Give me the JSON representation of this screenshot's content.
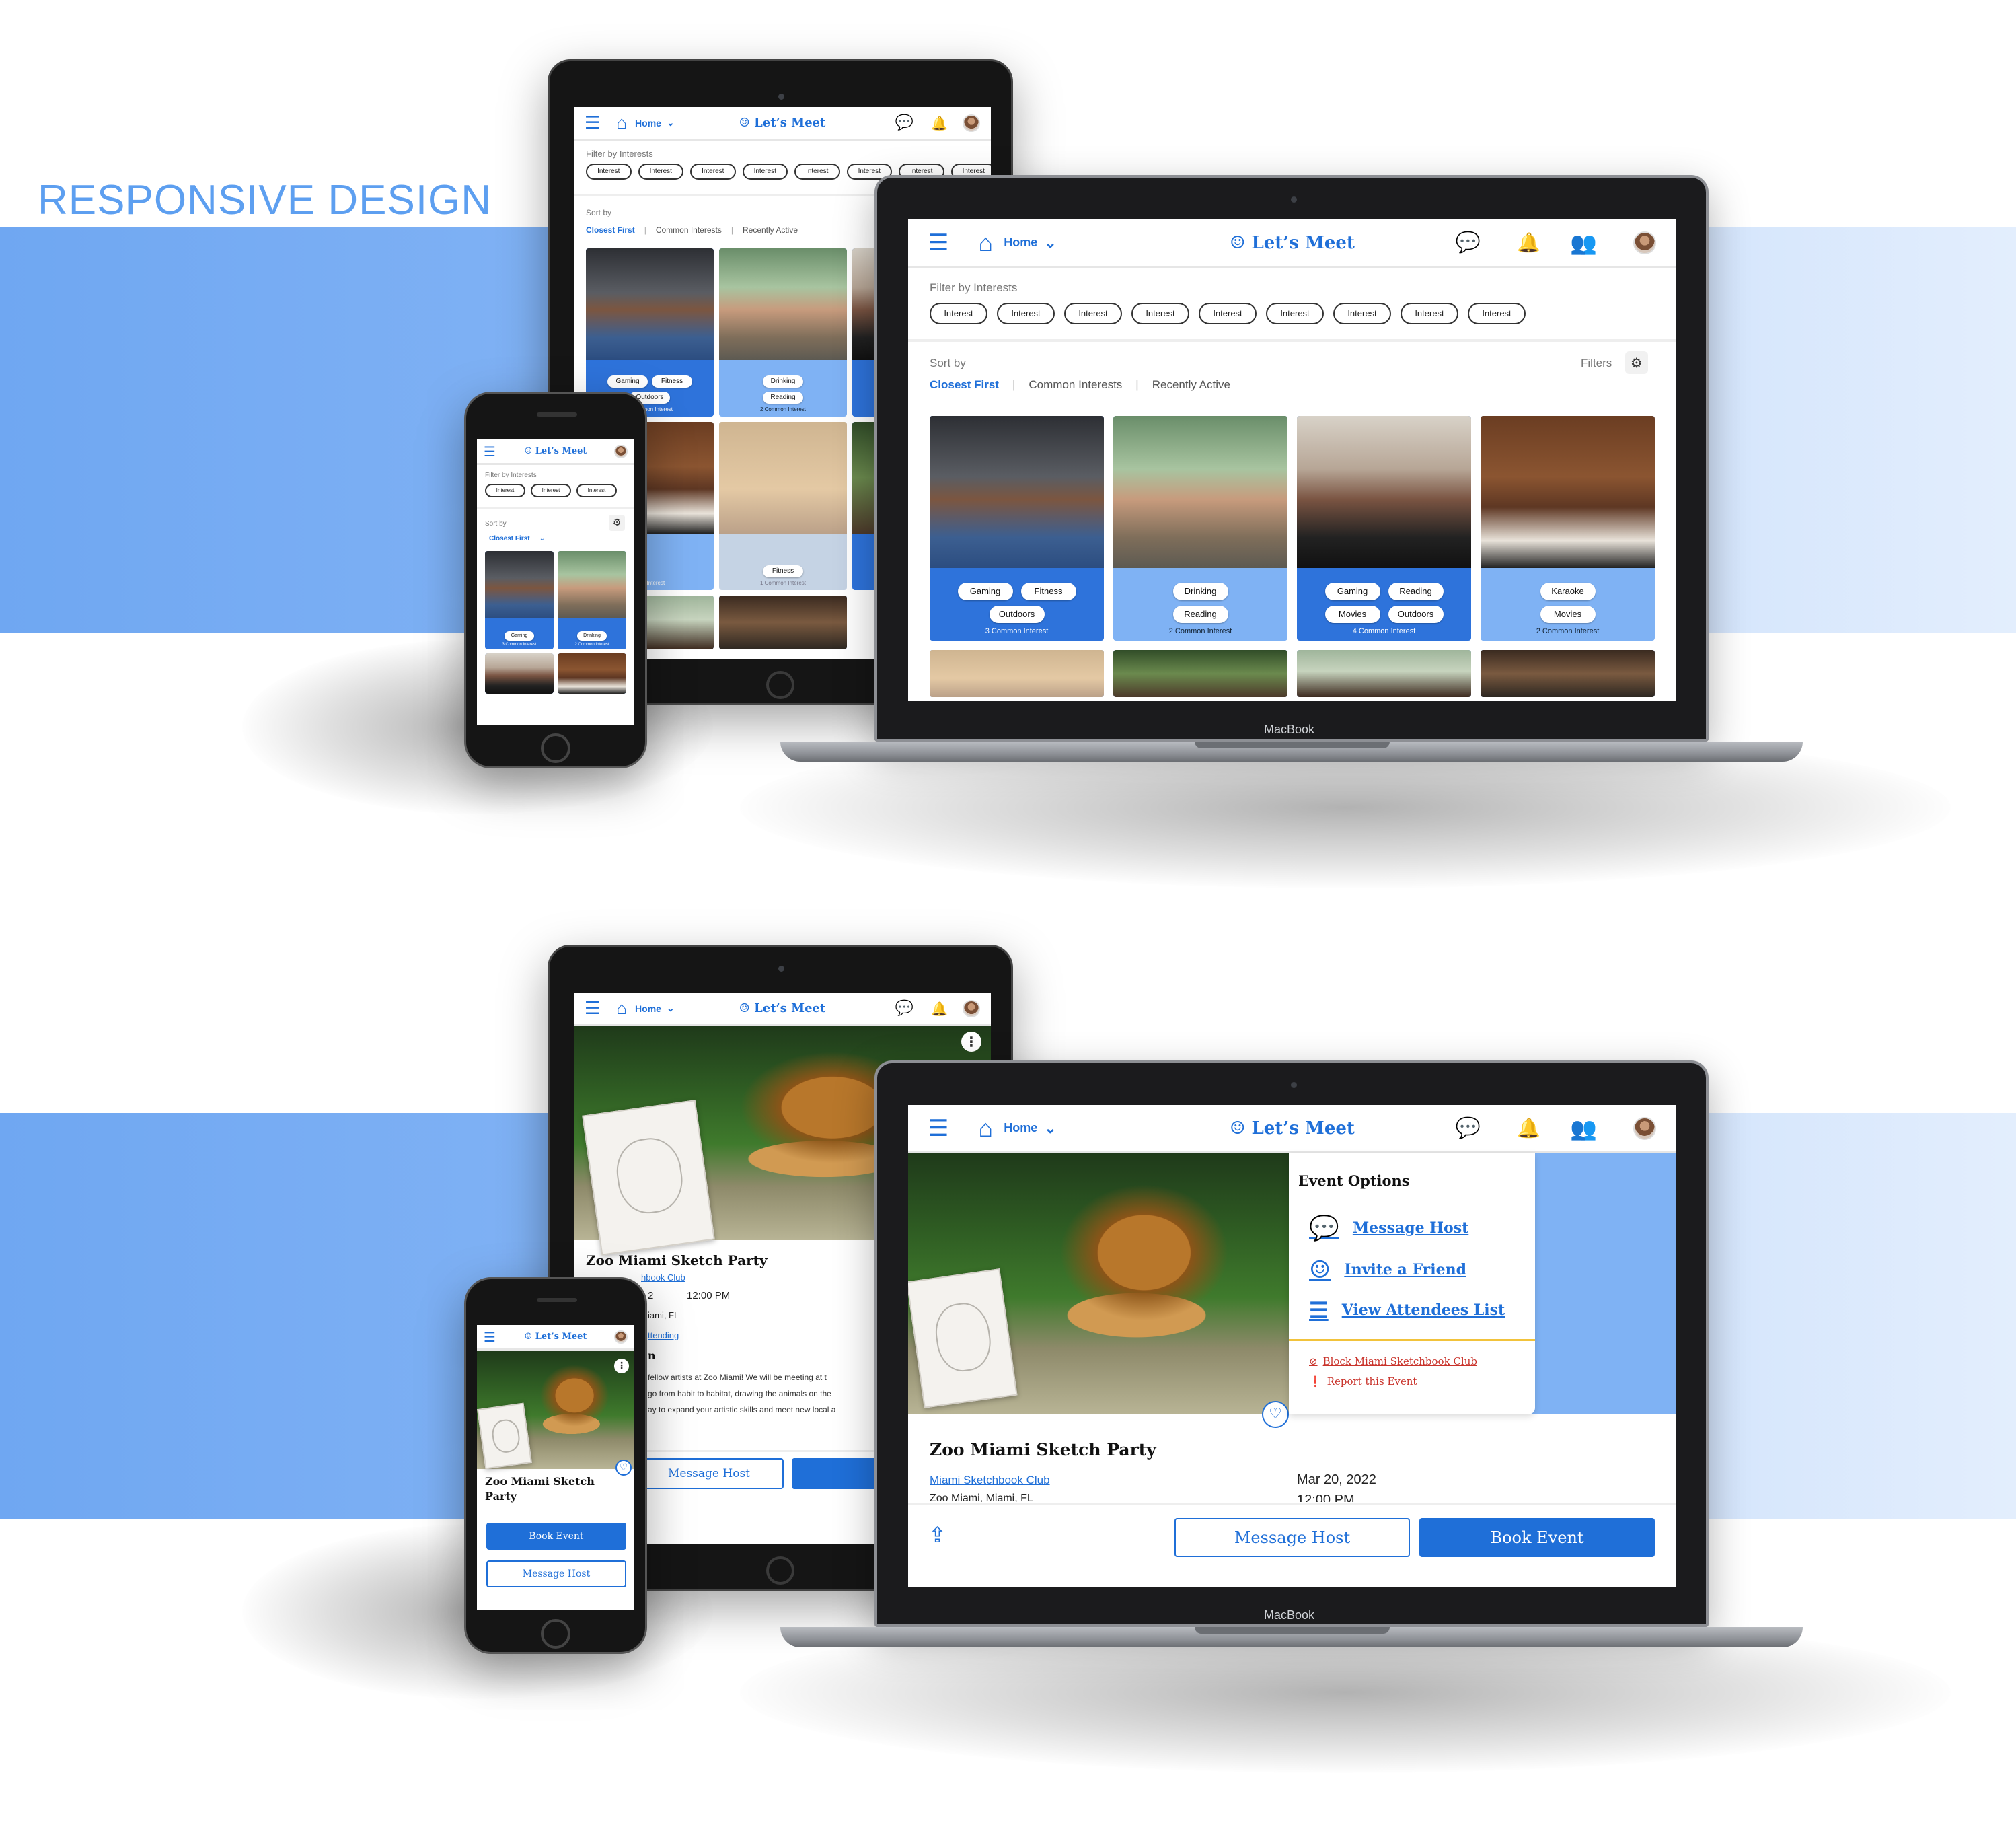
{
  "heading": "RESPONSIVE DESIGN",
  "colors": {
    "accent": "#1f6fd8",
    "band": "#6fa7f2",
    "warn": "#c9332b"
  },
  "nav": {
    "menu_icon": "hamburger-icon",
    "home_label": "Home",
    "brand": "Let’s Meet",
    "icons": [
      "chat-icon",
      "bell-icon",
      "people-icon",
      "avatar"
    ]
  },
  "browse": {
    "filter_label": "Filter by Interests",
    "chip_label": "Interest",
    "chip_count": 9,
    "sort_label": "Sort by",
    "sort_options": [
      "Closest First",
      "Common Interests",
      "Recently Active"
    ],
    "filters_label": "Filters",
    "cards": [
      {
        "tags": [
          "Gaming",
          "Fitness",
          "Outdoors"
        ],
        "common": "3 Common Interest"
      },
      {
        "tags": [
          "Drinking",
          "Reading"
        ],
        "common": "2 Common Interest"
      },
      {
        "tags": [
          "Gaming",
          "Reading",
          "Movies",
          "Outdoors"
        ],
        "common": "4 Common Interest"
      },
      {
        "tags": [
          "Karaoke",
          "Movies"
        ],
        "common": "2 Common Interest"
      }
    ],
    "tablet_card": {
      "tags": [
        "Fitness"
      ],
      "common": "1 Common Interest"
    },
    "tablet_card_partial": {
      "tags": [
        "oke",
        "ies"
      ],
      "common": "mon Interest"
    }
  },
  "event": {
    "title": "Zoo Miami Sketch Party",
    "phone_title_lines": [
      "Zoo Miami Sketch",
      "Party"
    ],
    "host": "Miami Sketchbook Club",
    "host_partial": "hbook Club",
    "date": "Mar 20, 2022",
    "time": "12:00 PM",
    "time_partial": "12:00 PM",
    "date_partial": "2",
    "location": "Zoo Miami, Miami, FL",
    "location_partial": "iami, FL",
    "attending_partial": "ttending",
    "about_partial": "n",
    "desc_lines": [
      " fellow artists at Zoo Miami! We will be meeting at t",
      "go from habit to habitat, drawing the animals on the",
      "ay to expand your artistic skills and meet new local a"
    ],
    "options_title": "Event Options",
    "options": [
      "Message Host",
      "Invite a Friend",
      "View Attendees List"
    ],
    "warn_options": [
      "Block Miami Sketchbook Club",
      "Report this Event"
    ],
    "message_btn": "Message Host",
    "book_btn": "Book Event",
    "tablet_message_btn": "Message Host",
    "tablet_book_partial": "Book"
  },
  "device_label": "MacBook"
}
